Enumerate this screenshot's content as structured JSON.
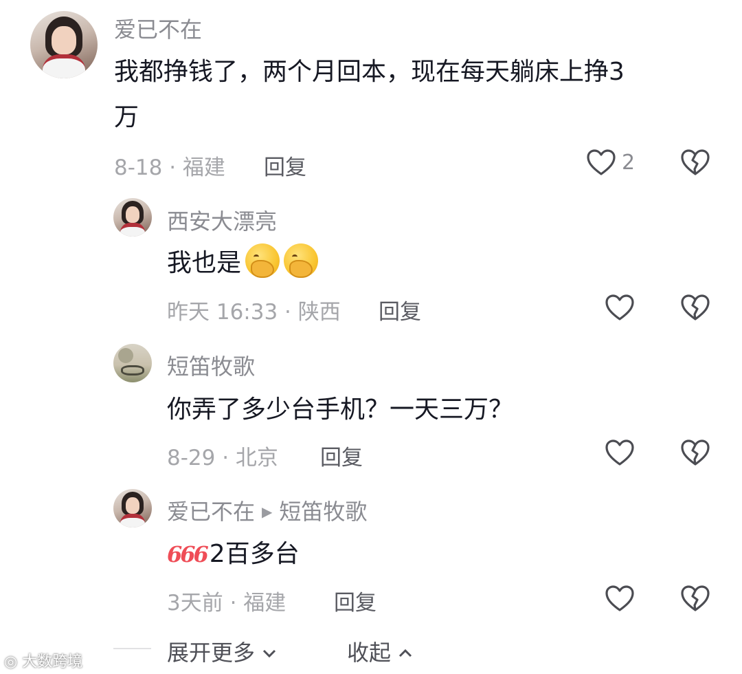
{
  "comments": [
    {
      "username": "爱已不在",
      "text_line1": "我都挣钱了，两个月回本，现在每天躺床上挣3",
      "text_line2": "万",
      "meta": "8-18 · 福建",
      "reply": "回复",
      "like_count": "2",
      "avatar": "avatar-girl"
    },
    {
      "username": "西安大漂亮",
      "text": "我也是",
      "emojis": [
        "hand-over-mouth-emoji",
        "hand-over-mouth-emoji"
      ],
      "meta": "昨天 16:33 · 陕西",
      "reply": "回复",
      "avatar": "avatar-girl"
    },
    {
      "username": "短笛牧歌",
      "text": "你弄了多少台手机？一天三万？",
      "meta": "8-29 · 北京",
      "reply": "回复",
      "avatar": "avatar-scene"
    },
    {
      "username": "爱已不在",
      "reply_to": "短笛牧歌",
      "prefix": "666",
      "text": "2百多台",
      "meta": "3天前 · 福建",
      "reply": "回复",
      "avatar": "avatar-girl"
    }
  ],
  "footer": {
    "expand": "展开更多",
    "collapse": "收起"
  },
  "watermark": "大数跨境",
  "colors": {
    "text": "#161823",
    "username": "#8a8b91",
    "meta": "#a5a6aa",
    "icon": "#4b4c52",
    "badge": "#ef4d57"
  }
}
